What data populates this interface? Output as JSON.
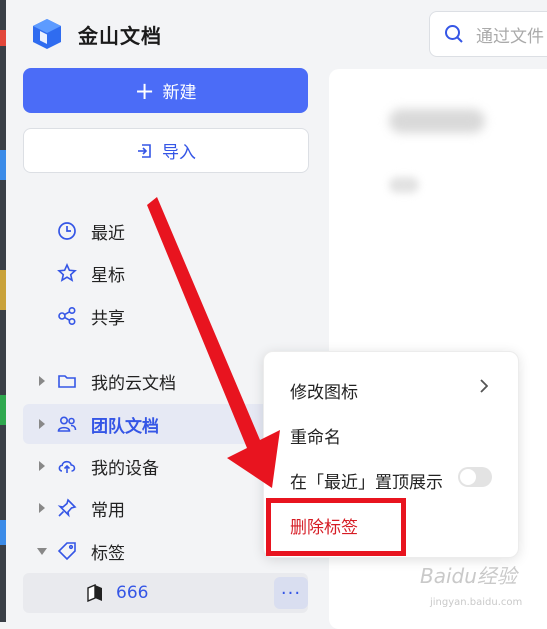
{
  "app": {
    "title": "金山文档",
    "logo_icon": "wps-docs-logo-icon"
  },
  "search": {
    "placeholder": "通过文件",
    "icon": "search-icon"
  },
  "actions": {
    "new_label": "新建",
    "import_label": "导入"
  },
  "nav": {
    "quick": [
      {
        "label": "最近",
        "icon": "clock-icon"
      },
      {
        "label": "星标",
        "icon": "star-icon"
      },
      {
        "label": "共享",
        "icon": "share-icon"
      }
    ],
    "tree": [
      {
        "label": "我的云文档",
        "icon": "folder-icon",
        "expanded": false,
        "active": false
      },
      {
        "label": "团队文档",
        "icon": "team-icon",
        "expanded": false,
        "active": true
      },
      {
        "label": "我的设备",
        "icon": "cloud-upload-icon",
        "expanded": false,
        "active": false
      },
      {
        "label": "常用",
        "icon": "pin-icon",
        "expanded": false,
        "active": false
      },
      {
        "label": "标签",
        "icon": "tag-icon",
        "expanded": true,
        "active": false
      }
    ],
    "tag_items": [
      {
        "label": "666",
        "icon": "bookmark-icon",
        "more_label": "···"
      }
    ]
  },
  "context_menu": {
    "items": [
      {
        "label": "修改图标",
        "has_submenu": true
      },
      {
        "label": "重命名"
      },
      {
        "label": "在「最近」置顶展示",
        "toggle": false
      },
      {
        "label": "删除标签",
        "danger": true,
        "highlighted": true
      }
    ]
  },
  "watermark": {
    "text": "Baidu经验",
    "sub": "jingyan.baidu.com"
  },
  "colors": {
    "accent": "#4b6cf7",
    "active_text": "#3556e6",
    "danger": "#d61c24",
    "annotation_red": "#e8141f"
  }
}
